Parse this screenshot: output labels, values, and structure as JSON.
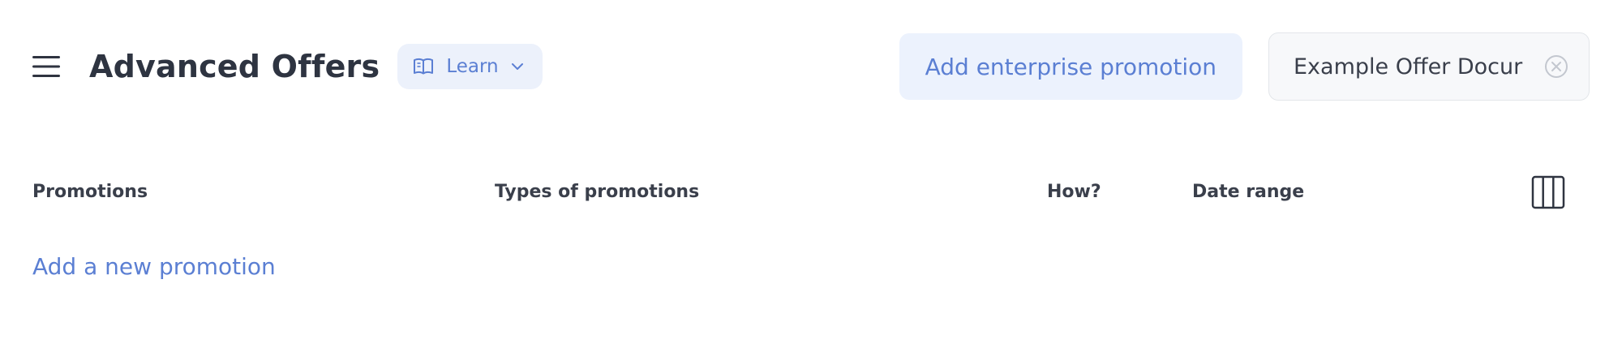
{
  "header": {
    "title": "Advanced Offers",
    "learn_label": "Learn",
    "add_enterprise_label": "Add enterprise promotion",
    "selected_offer": "Example Offer Docur"
  },
  "table": {
    "columns": [
      "Promotions",
      "Types of promotions",
      "How?",
      "Date range"
    ]
  },
  "actions": {
    "add_promotion_label": "Add a new promotion"
  },
  "icons": {
    "menu": "hamburger-menu-icon",
    "learn": "book-icon",
    "learn_dropdown": "chevron-down-icon",
    "clear_offer": "close-circle-icon",
    "columns": "columns-icon"
  },
  "colors": {
    "accent": "#5b7fd3",
    "chip_bg": "#ecf1fb",
    "title": "#2e3441"
  }
}
